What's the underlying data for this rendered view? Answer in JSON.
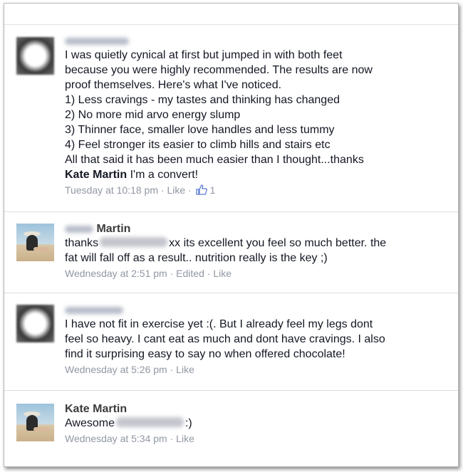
{
  "comments": [
    {
      "author": "",
      "lines": [
        "I was quietly cynical at first but jumped in with both feet",
        "because you were highly recommended. The results are now",
        "proof themselves. Here's what I've noticed.",
        "1) Less cravings - my tastes and thinking has changed",
        "2) No more mid arvo energy slump",
        "3) Thinner face, smaller love handles and less tummy",
        "4) Feel stronger its easier to climb hills and stairs etc",
        "All that said it has been much easier than I thought...thanks"
      ],
      "mention": "Kate Martin",
      "tail": " I'm a convert!",
      "timestamp": "Tuesday at 10:18 pm",
      "actions": [
        "Like"
      ],
      "like_count": "1"
    },
    {
      "author": "Martin",
      "line1_prefix": "thanks",
      "line1_suffix": "xx its excellent you feel so much better. the",
      "line2": "fat will fall off as a result.. nutrition really is the key ;)",
      "timestamp": "Wednesday at 2:51 pm",
      "edited": "Edited",
      "actions": [
        "Like"
      ]
    },
    {
      "author": "",
      "lines": [
        "I have not fit in exercise yet :(. But I already feel my legs dont",
        "feel so heavy. I cant eat as much and dont have cravings.  I also",
        "find it surprising easy to say no when offered chocolate!"
      ],
      "timestamp": "Wednesday at 5:26 pm",
      "actions": [
        "Like"
      ]
    },
    {
      "author": "Kate Martin",
      "text_prefix": "Awesome",
      "text_suffix": ":)",
      "timestamp": "Wednesday at 5:34 pm",
      "actions": [
        "Like"
      ]
    }
  ],
  "separator": " · ",
  "icons": {
    "like": "thumbs-up-icon"
  },
  "colors": {
    "meta": "#9197a3",
    "text": "#141823",
    "like_blue": "#5b7bd5"
  }
}
